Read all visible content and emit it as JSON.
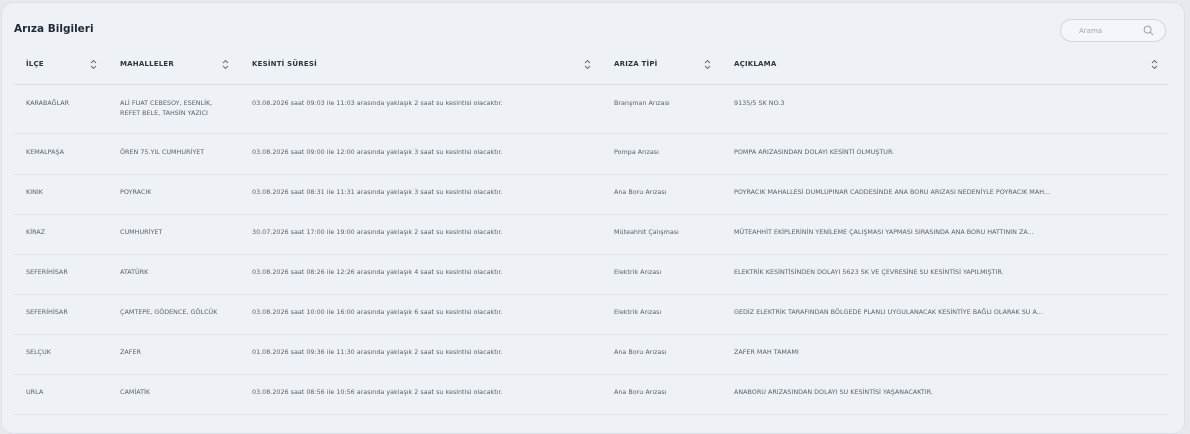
{
  "page": {
    "title": "Arıza Bilgileri",
    "search_placeholder": "Arama"
  },
  "columns": [
    {
      "label": "İLÇE"
    },
    {
      "label": "MAHALLELER"
    },
    {
      "label": "KESİNTİ SÜRESİ"
    },
    {
      "label": "ARIZA TİPİ"
    },
    {
      "label": "AÇIKLAMA"
    }
  ],
  "rows": [
    {
      "ilce": "KARABAĞLAR",
      "mahalle": "ALİ FUAT CEBESOY, ESENLİK, REFET BELE, TAHSİN YAZICI",
      "sure": "03.08.2026 saat 09:03 ile 11:03 arasında yaklaşık 2 saat su kesintisi olacaktır.",
      "tip": "Branşman Arızası",
      "aciklama": "9135/5 SK NO.3"
    },
    {
      "ilce": "KEMALPAŞA",
      "mahalle": "ÖREN 75.YIL CUMHURİYET",
      "sure": "03.08.2026 saat 09:00 ile 12:00 arasında yaklaşık 3 saat su kesintisi olacaktır.",
      "tip": "Pompa Arızası",
      "aciklama": "POMPA ARIZASINDAN DOLAYI KESİNTİ OLMUŞTUR."
    },
    {
      "ilce": "KINIK",
      "mahalle": "POYRACIK",
      "sure": "03.08.2026 saat 08:31 ile 11:31 arasında yaklaşık 3 saat su kesintisi olacaktır.",
      "tip": "Ana Boru Arızası",
      "aciklama": "POYRACIK MAHALLESİ DUMLUPINAR CADDESİNDE ANA BORU ARIZASI NEDENİYLE POYRACIK MAH..."
    },
    {
      "ilce": "KİRAZ",
      "mahalle": "CUMHURİYET",
      "sure": "30.07.2026 saat 17:00 ile 19:00 arasında yaklaşık 2 saat su kesintisi olacaktır.",
      "tip": "Müteahhit Çalışması",
      "aciklama": "MÜTEAHHİT EKİPLERİNİN YENİLEME ÇALIŞMASI YAPMASI SIRASINDA ANA BORU HATTININ ZA..."
    },
    {
      "ilce": "SEFERİHİSAR",
      "mahalle": "ATATÜRK",
      "sure": "03.08.2026 saat 08:26 ile 12:26 arasında yaklaşık 4 saat su kesintisi olacaktır.",
      "tip": "Elektrik Arızası",
      "aciklama": "ELEKTRİK KESİNTİSİNDEN DOLAYI 5623 SK VE ÇEVRESİNE SU KESİNTİSİ YAPILMIŞTIR."
    },
    {
      "ilce": "SEFERİHİSAR",
      "mahalle": "ÇAMTEPE, GÖDENCE, GÖLCÜK",
      "sure": "03.08.2026 saat 10:00 ile 16:00 arasında yaklaşık 6 saat su kesintisi olacaktır.",
      "tip": "Elektrik Arızası",
      "aciklama": "GEDİZ ELEKTRİK TARAFINDAN BÖLGEDE PLANLI UYGULANACAK KESİNTİYE BAĞLI OLARAK SU A..."
    },
    {
      "ilce": "SELÇUK",
      "mahalle": "ZAFER",
      "sure": "01.08.2026 saat 09:36 ile 11:30 arasında yaklaşık 2 saat su kesintisi olacaktır.",
      "tip": "Ana Boru Arızası",
      "aciklama": "ZAFER MAH TAMAMI"
    },
    {
      "ilce": "URLA",
      "mahalle": "CAMİATİK",
      "sure": "03.08.2026 saat 08:56 ile 10:56 arasında yaklaşık 2 saat su kesintisi olacaktır.",
      "tip": "Ana Boru Arızası",
      "aciklama": "ANABORU ARIZASINDAN DOLAYI SU KESİNTİSİ YAŞANACAKTIR."
    }
  ],
  "icons": {
    "search": "search-icon",
    "sort": "sort-icon"
  },
  "colors": {
    "background": "#e6eaee",
    "panel": "#eef1f5",
    "text": "#56616d"
  }
}
